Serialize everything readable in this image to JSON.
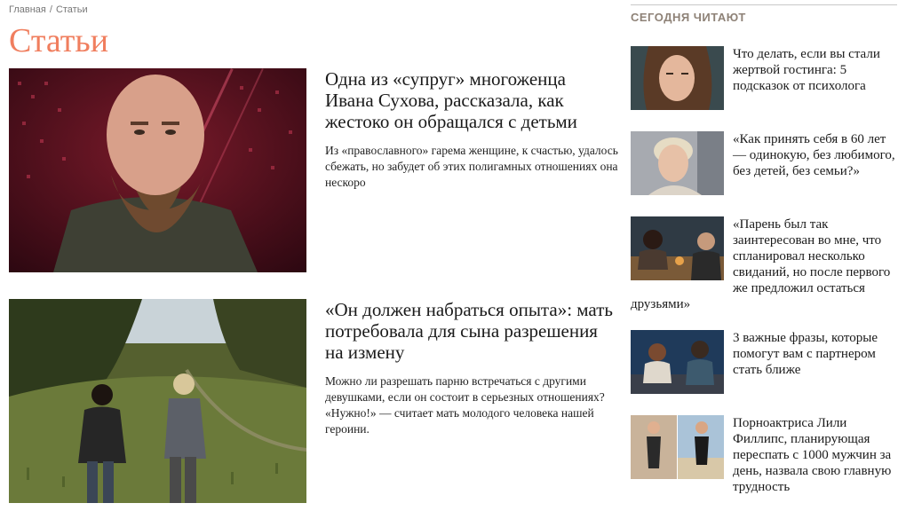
{
  "breadcrumb": {
    "home": "Главная",
    "separator": "/",
    "current": "Статьи"
  },
  "page_title": "Статьи",
  "articles": [
    {
      "title": "Одна из «супруг» многоженца Ивана Сухова, рассказала, как жестоко он обращался с детьми",
      "excerpt": "Из «православного» гарема женщине, к счастью, удалось сбежать, но забудет об этих полигамных отношениях она нескоро"
    },
    {
      "title": "«Он должен набраться опыта»: мать потребовала для сына разрешения на измену",
      "excerpt": "Можно ли разрешать парню встречаться с другими девушками, если он состоит в серьезных отношениях? «Нужно!» — считает мать молодого человека нашей героини."
    }
  ],
  "sidebar": {
    "heading": "СЕГОДНЯ ЧИТАЮТ",
    "items": [
      {
        "title": "Что делать, если вы стали жертвой гостинга: 5 подсказок от психолога"
      },
      {
        "title": "«Как принять себя в 60 лет — одинокую, без любимого, без детей, без семьи?»"
      },
      {
        "title": "«Парень был так заинтересован во мне, что спланировал несколько свиданий, но после первого же предложил остаться друзьями»"
      },
      {
        "title": "3 важные фразы, которые помогут вам с партнером стать ближе"
      },
      {
        "title": "Порноактриса Лили Филлипс, планирующая переспать с 1000 мужчин за день, назвала свою главную трудность"
      }
    ]
  }
}
